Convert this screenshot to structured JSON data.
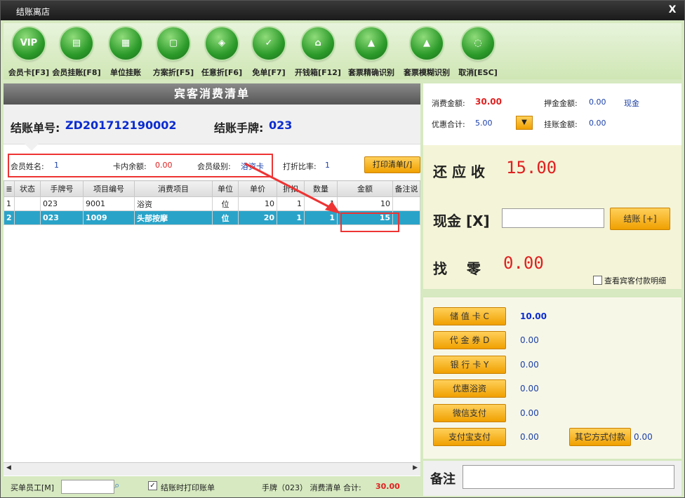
{
  "window": {
    "title": "结账离店",
    "close_glyph": "X"
  },
  "toolbar": [
    {
      "label": "会员卡[F3]",
      "icon": "VIP"
    },
    {
      "label": "会员挂账[F8]",
      "icon": "doc"
    },
    {
      "label": "单位挂账",
      "icon": "doc"
    },
    {
      "label": "方案折[F5]",
      "icon": "window"
    },
    {
      "label": "任意折[F6]",
      "icon": "shirt"
    },
    {
      "label": "免单[F7]",
      "icon": "check"
    },
    {
      "label": "开钱箱[F12]",
      "icon": "safe"
    },
    {
      "label": "套票精确识别",
      "icon": "triangle"
    },
    {
      "label": "套票模糊识别",
      "icon": "triangle"
    },
    {
      "label": "取消[ESC]",
      "icon": "ring"
    }
  ],
  "list": {
    "title": "宾客消费清单"
  },
  "bill": {
    "no_label": "结账单号:",
    "no_value": "ZD201712190002",
    "tag_label": "结账手牌:",
    "tag_value": "023"
  },
  "member": {
    "name_label": "会员姓名:",
    "name_value": "1",
    "balance_label": "卡内余额:",
    "balance_value": "0.00",
    "level_label": "会员级别:",
    "level_value": "浴资卡",
    "discount_label": "打折比率:",
    "discount_value": "1",
    "print_button": "打印清单[/]"
  },
  "table": {
    "columns": [
      "≣",
      "状态",
      "手牌号",
      "项目编号",
      "消费项目",
      "单位",
      "单价",
      "折扣",
      "数量",
      "金额",
      "备注说"
    ],
    "rows": [
      [
        "1",
        "",
        "023",
        "9001",
        "浴资",
        "位",
        "10",
        "1",
        "1",
        "10",
        ""
      ],
      [
        "2",
        "",
        "023",
        "1009",
        "头部按摩",
        "位",
        "20",
        "1",
        "1",
        "15",
        ""
      ]
    ]
  },
  "status": {
    "staff_label": "买单员工[M]",
    "staff_value": "",
    "print_checkbox_label": "结账时打印账单",
    "summary_prefix": "手牌（023） 消费清单 合计:",
    "summary_total": "30.00"
  },
  "summary": {
    "consume_label": "消费金额:",
    "consume_value": "30.00",
    "deposit_label": "押金金额:",
    "deposit_value": "0.00",
    "deposit_type": "现金",
    "discount_label": "优惠合计:",
    "discount_value": "5.00",
    "credit_label": "挂账金额:",
    "credit_value": "0.00"
  },
  "settle": {
    "due_label": "还 应 收",
    "due_value": "15.00",
    "cash_label": "现金 [X]",
    "cash_value": "",
    "pay_button": "结账 [+]",
    "change_label": "找    零",
    "change_value": "0.00",
    "detail_checkbox": "查看宾客付款明细"
  },
  "payments": [
    {
      "label": "储 值 卡 C",
      "value": "10.00"
    },
    {
      "label": "代 金 券 D",
      "value": "0.00"
    },
    {
      "label": "银 行 卡 Y",
      "value": "0.00"
    },
    {
      "label": "优惠浴资",
      "value": "0.00"
    },
    {
      "label": "微信支付",
      "value": "0.00"
    },
    {
      "label": "支付宝支付",
      "value": "0.00"
    }
  ],
  "other_payment": {
    "label": "其它方式付款",
    "value": "0.00"
  },
  "note": {
    "label": "备注",
    "value": ""
  },
  "colors": {
    "accent_red": "#e02020",
    "accent_blue": "#0a2bd0",
    "button_orange": "#f0a000",
    "selected_row": "#2aa3c8"
  }
}
